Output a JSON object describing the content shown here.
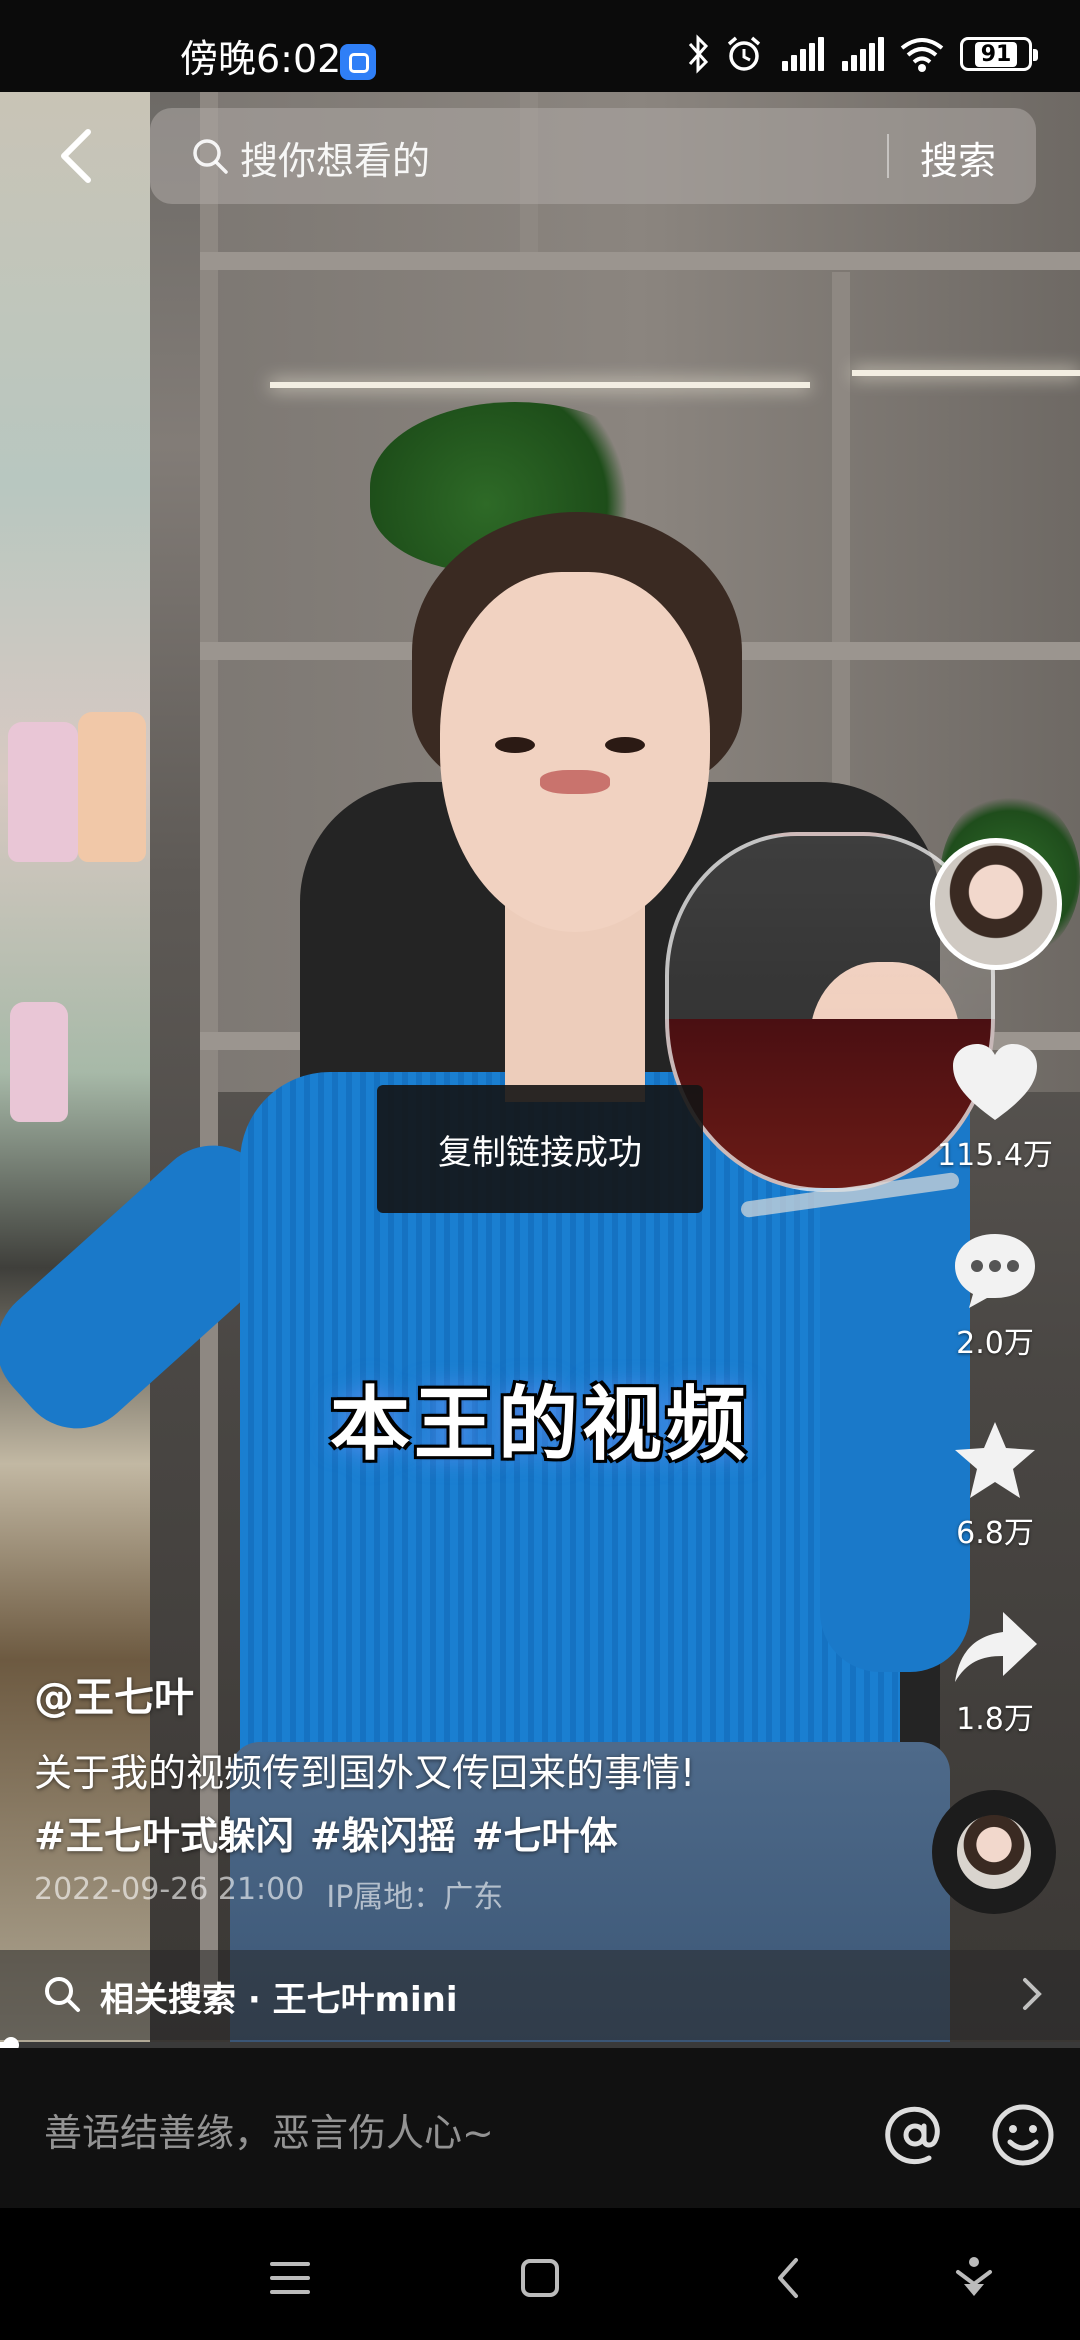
{
  "status_bar": {
    "time": "傍晚6:02",
    "battery": "91",
    "icons": [
      "bluetooth-icon",
      "alarm-icon",
      "signal-hd-icon",
      "signal-hd-icon",
      "wifi-icon",
      "battery-icon"
    ]
  },
  "top_bar": {
    "search_placeholder": "搜你想看的",
    "search_button": "搜索"
  },
  "toast": "复制链接成功",
  "caption": "本王的视频",
  "rail": {
    "likes": "115.4万",
    "comments": "2.0万",
    "favorites": "6.8万",
    "shares": "1.8万"
  },
  "post": {
    "author": "@王七叶",
    "description": "关于我的视频传到国外又传回来的事情!",
    "hashtags": [
      "#王七叶式躲闪",
      "#躲闪摇",
      "#七叶体"
    ],
    "datetime": "2022-09-26 21:00",
    "ip_location": "IP属地：广东"
  },
  "related_search": "相关搜索 · 王七叶mini",
  "progress": 0.01,
  "comment_input": {
    "placeholder": "善语结善缘，恶言伤人心~"
  },
  "colors": {
    "accent_sweater": "#1a7fd1",
    "toast_bg": "#141414"
  }
}
